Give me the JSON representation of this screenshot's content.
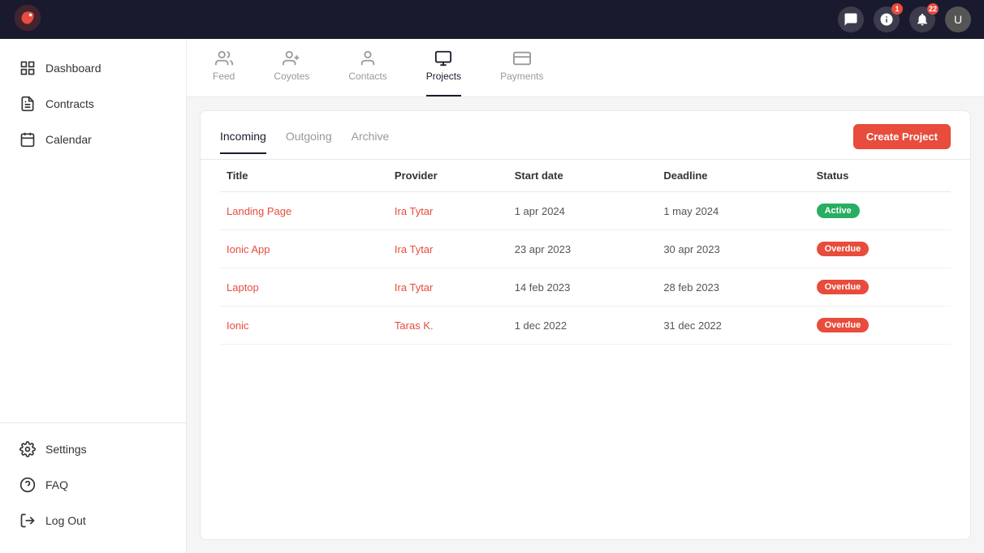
{
  "app": {
    "logo_alt": "Coyotes Logo"
  },
  "topbar": {
    "icons": [
      {
        "name": "chat-icon",
        "badge": null
      },
      {
        "name": "message-icon",
        "badge": "1"
      },
      {
        "name": "bell-icon",
        "badge": "22"
      }
    ],
    "avatar_label": "U"
  },
  "sidebar": {
    "nav_items": [
      {
        "key": "dashboard",
        "label": "Dashboard",
        "active": false
      },
      {
        "key": "contracts",
        "label": "Contracts",
        "active": false
      },
      {
        "key": "calendar",
        "label": "Calendar",
        "active": false
      }
    ],
    "bottom_items": [
      {
        "key": "settings",
        "label": "Settings"
      },
      {
        "key": "faq",
        "label": "FAQ"
      },
      {
        "key": "logout",
        "label": "Log Out"
      }
    ]
  },
  "tabs": [
    {
      "key": "feed",
      "label": "Feed",
      "active": false
    },
    {
      "key": "coyotes",
      "label": "Coyotes",
      "active": false
    },
    {
      "key": "contacts",
      "label": "Contacts",
      "active": false
    },
    {
      "key": "projects",
      "label": "Projects",
      "active": true
    },
    {
      "key": "payments",
      "label": "Payments",
      "active": false
    }
  ],
  "sub_tabs": [
    {
      "key": "incoming",
      "label": "Incoming",
      "active": true
    },
    {
      "key": "outgoing",
      "label": "Outgoing",
      "active": false
    },
    {
      "key": "archive",
      "label": "Archive",
      "active": false
    }
  ],
  "create_button_label": "Create Project",
  "table": {
    "columns": [
      "Title",
      "Provider",
      "Start date",
      "Deadline",
      "Status"
    ],
    "rows": [
      {
        "title": "Landing Page",
        "provider": "Ira Tytar",
        "start_date": "1 apr 2024",
        "deadline": "1 may 2024",
        "status": "Active",
        "status_type": "active"
      },
      {
        "title": "Ionic App",
        "provider": "Ira Tytar",
        "start_date": "23 apr 2023",
        "deadline": "30 apr 2023",
        "status": "Overdue",
        "status_type": "overdue"
      },
      {
        "title": "Laptop",
        "provider": "Ira Tytar",
        "start_date": "14 feb 2023",
        "deadline": "28 feb 2023",
        "status": "Overdue",
        "status_type": "overdue"
      },
      {
        "title": "Ionic",
        "provider": "Taras K.",
        "start_date": "1 dec 2022",
        "deadline": "31 dec 2022",
        "status": "Overdue",
        "status_type": "overdue"
      }
    ]
  }
}
